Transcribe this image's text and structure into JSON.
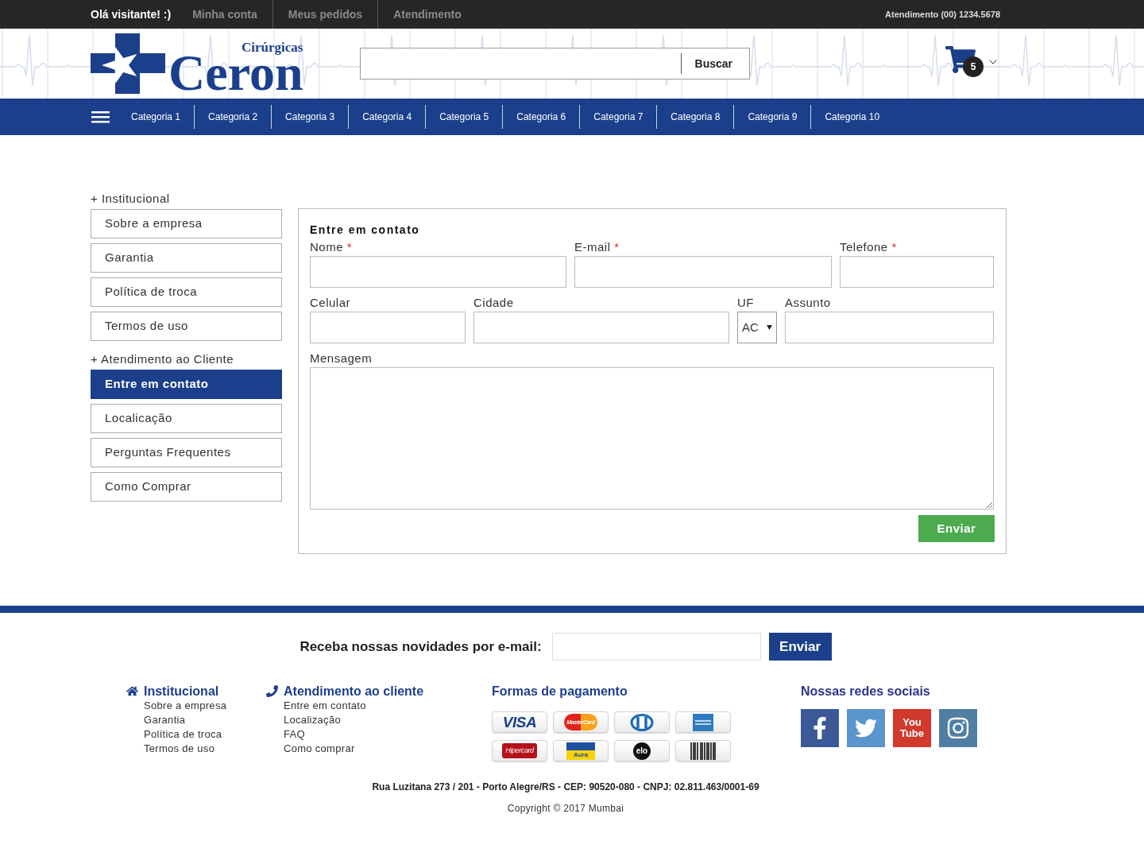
{
  "top_bar": {
    "greeting": "Olá visitante! :)",
    "links": [
      "Minha conta",
      "Meus pedidos",
      "Atendimento"
    ],
    "phone": "Atendimento (00) 1234.5678"
  },
  "header": {
    "logo": {
      "subtitle": "Cirúrgicas",
      "name": "Ceron"
    },
    "search": {
      "button": "Buscar"
    },
    "cart": {
      "count": "5"
    }
  },
  "categories": [
    "Categoria 1",
    "Categoria 2",
    "Categoria 3",
    "Categoria 4",
    "Categoria 5",
    "Categoria 6",
    "Categoria 7",
    "Categoria 8",
    "Categoria 9",
    "Categoria 10"
  ],
  "sidebar": {
    "sections": [
      {
        "title": "+ Institucional",
        "items": [
          {
            "label": "Sobre a empresa",
            "selected": false
          },
          {
            "label": "Garantia",
            "selected": false
          },
          {
            "label": "Política de troca",
            "selected": false
          },
          {
            "label": "Termos de uso",
            "selected": false
          }
        ]
      },
      {
        "title": "+ Atendimento ao Cliente",
        "items": [
          {
            "label": "Entre em contato",
            "selected": true
          },
          {
            "label": "Localicação",
            "selected": false
          },
          {
            "label": "Perguntas Frequentes",
            "selected": false
          },
          {
            "label": "Como Comprar",
            "selected": false
          }
        ]
      }
    ]
  },
  "contact_form": {
    "title": "Entre em contato",
    "rows": [
      {
        "fields": [
          {
            "kind": "text",
            "label": "Nome",
            "required_mark": "*"
          },
          {
            "kind": "text",
            "label": "E-mail",
            "required_mark": "*"
          },
          {
            "kind": "text",
            "label": "Telefone",
            "required_mark": "*"
          }
        ]
      },
      {
        "fields": [
          {
            "kind": "text",
            "label": "Celular"
          },
          {
            "kind": "text",
            "label": "Cidade"
          },
          {
            "kind": "select",
            "label": "UF",
            "value": "AC"
          },
          {
            "kind": "text",
            "label": "Assunto"
          }
        ]
      },
      {
        "fields": [
          {
            "kind": "textarea",
            "label": "Mensagem"
          }
        ]
      }
    ],
    "submit": "Enviar"
  },
  "footer": {
    "newsletter": {
      "label": "Receba nossas novidades por e-mail:",
      "button": "Enviar"
    },
    "columns": [
      {
        "title": "Institucional",
        "links": [
          "Sobre a empresa",
          "Garantia",
          "Política de troca",
          "Termos de uso"
        ]
      },
      {
        "title": "Atendimento ao cliente",
        "links": [
          "Entre em contato",
          "Localização",
          "FAQ",
          "Como comprar"
        ]
      }
    ],
    "payment": {
      "title": "Formas de pagamento",
      "methods": [
        {
          "kind": "visa",
          "label": "VISA"
        },
        {
          "kind": "mastercard",
          "label": "MasterCard"
        },
        {
          "kind": "diners"
        },
        {
          "kind": "amex"
        },
        {
          "kind": "hipercard",
          "label": "Hipercard"
        },
        {
          "kind": "aura",
          "label": "Aura"
        },
        {
          "kind": "elo",
          "label": "elo"
        },
        {
          "kind": "boleto"
        }
      ]
    },
    "social": {
      "title": "Nossas redes sociais",
      "networks": [
        {
          "kind": "facebook"
        },
        {
          "kind": "twitter"
        },
        {
          "kind": "youtube",
          "label": "You Tube"
        },
        {
          "kind": "instagram"
        }
      ]
    },
    "address": "Rua Luzitana 273 / 201 - Porto Alegre/RS - CEP: 90520-080 - CNPJ: 02.811.463/0001-69",
    "copyright": "Copyright © 2017 Mumbai"
  }
}
